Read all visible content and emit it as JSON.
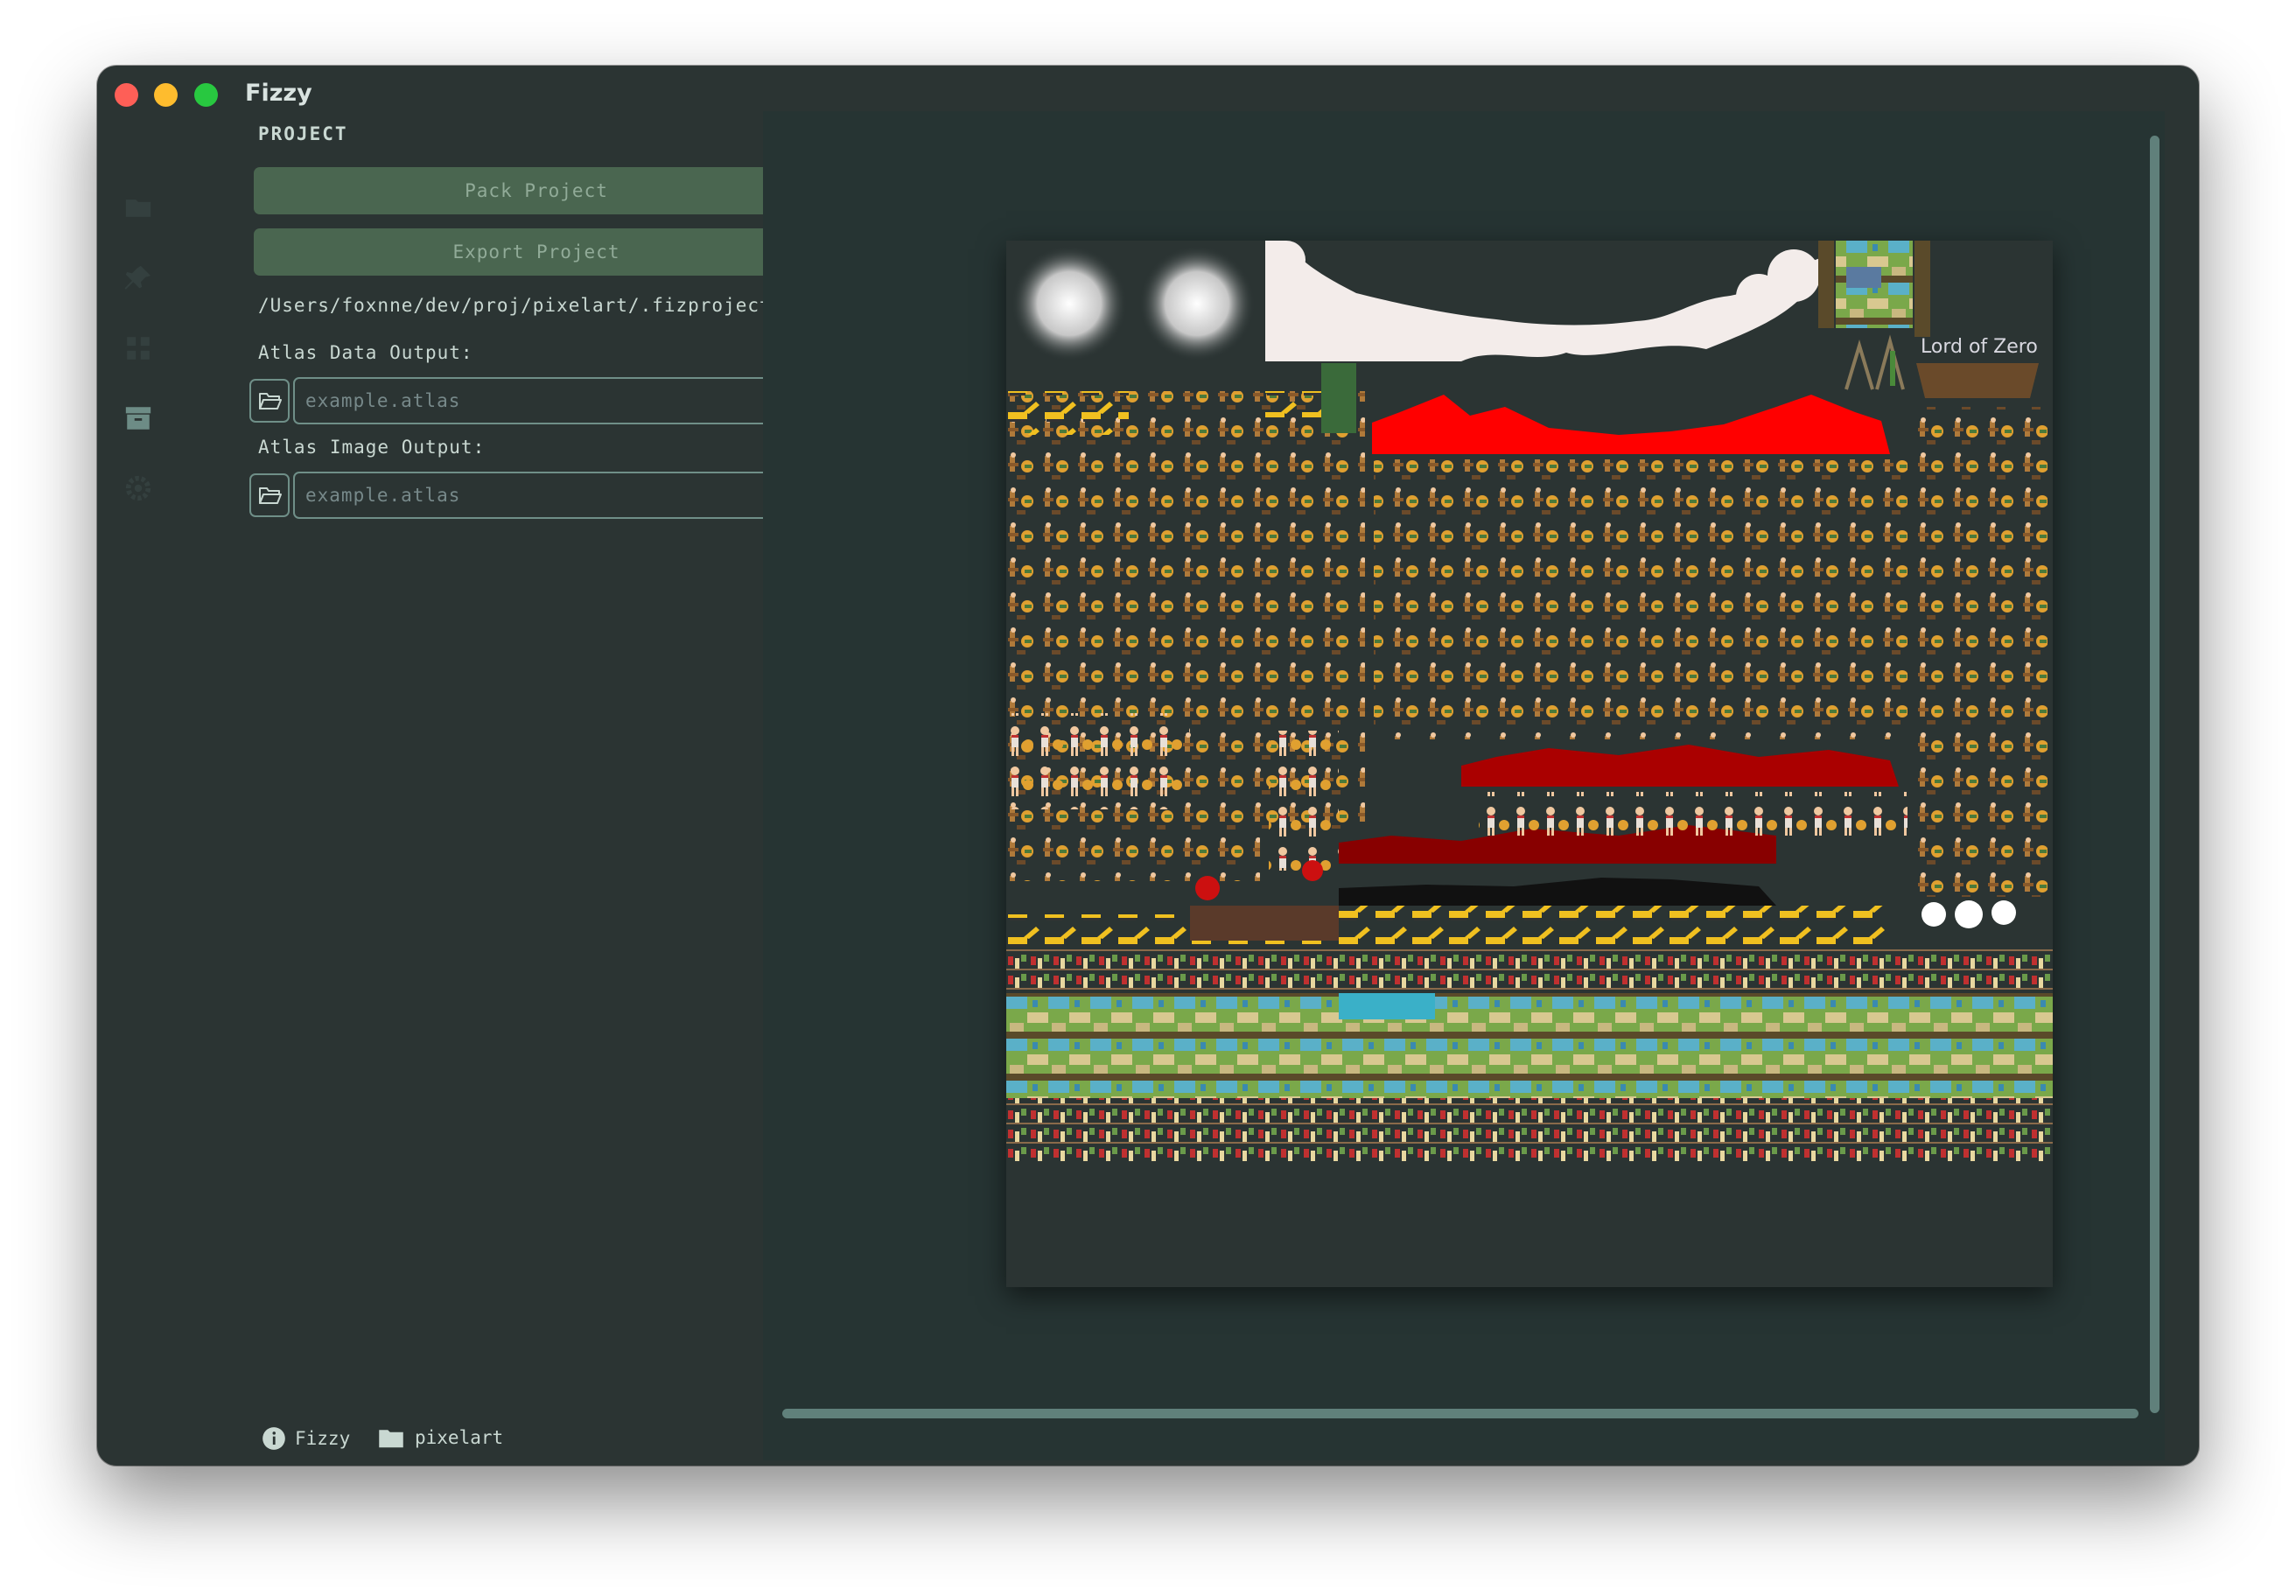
{
  "window": {
    "title": "Fizzy"
  },
  "sidebar_rail": {
    "icons": [
      "folder-icon",
      "pin-icon",
      "grid-icon",
      "archive-icon",
      "gear-icon"
    ],
    "active": "archive-icon"
  },
  "panel": {
    "section_title": "PROJECT",
    "pack_button": "Pack Project",
    "export_button": "Export Project",
    "project_path": "/Users/foxnne/dev/proj/pixelart/.fizproject",
    "atlas_data": {
      "label": "Atlas Data Output:",
      "placeholder": "example.atlas",
      "value": ""
    },
    "atlas_image": {
      "label": "Atlas Image Output:",
      "placeholder": "example.atlas",
      "value": ""
    }
  },
  "footer": {
    "app_label": "Fizzy",
    "folder_label": "pixelart"
  },
  "atlas": {
    "title_text": "Lord of Zero"
  },
  "colors": {
    "window_bg": "#2b3433",
    "main_bg": "#263433",
    "accent_button": "#4a6650",
    "text": "#c9d8d2"
  }
}
